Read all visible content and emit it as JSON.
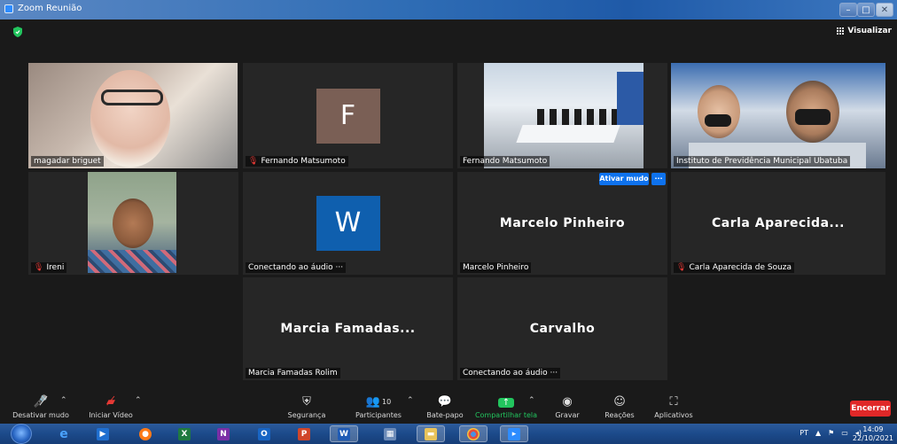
{
  "window": {
    "title": "Zoom Reunião",
    "view_label": "Visualizar"
  },
  "tiles": [
    {
      "id": "magadar",
      "name": "magadar briguet"
    },
    {
      "id": "fernando1",
      "name": "Fernando Matsumoto",
      "avatar_letter": "F",
      "muted": true
    },
    {
      "id": "fernando2",
      "name": "Fernando Matsumoto"
    },
    {
      "id": "instituto",
      "name": "Instituto de Previdência Municipal Ubatuba"
    },
    {
      "id": "ireni",
      "name": "Ireni",
      "muted": true
    },
    {
      "id": "w",
      "name": "Conectando ao áudio ···",
      "avatar_letter": "W"
    },
    {
      "id": "marcelo",
      "name": "Marcelo Pinheiro",
      "big_name": "Marcelo Pinheiro"
    },
    {
      "id": "carla",
      "name": "Carla Aparecida de Souza",
      "big_name": "Carla Aparecida...",
      "muted": true
    },
    {
      "id": "marcia",
      "name": "Marcia Famadas Rolim",
      "big_name": "Marcia Famadas..."
    },
    {
      "id": "carvalho",
      "name": "Conectando ao áudio ···",
      "big_name": "Carvalho"
    }
  ],
  "tile_actions": {
    "unmute_label": "Ativar mudo",
    "more_label": "···"
  },
  "toolbar": {
    "mute": "Desativar mudo",
    "video": "Iniciar Vídeo",
    "security": "Segurança",
    "participants": "Participantes",
    "participants_count": "10",
    "chat": "Bate-papo",
    "share": "Compartilhar tela",
    "record": "Gravar",
    "reactions": "Reações",
    "apps": "Aplicativos",
    "end": "Encerrar"
  },
  "taskbar": {
    "language": "PT",
    "time": "14:09",
    "date": "22/10/2021"
  },
  "colors": {
    "accent_blue": "#0e72ed",
    "share_green": "#22c55e",
    "end_red": "#e02828",
    "active_speaker": "#d8e84d"
  }
}
